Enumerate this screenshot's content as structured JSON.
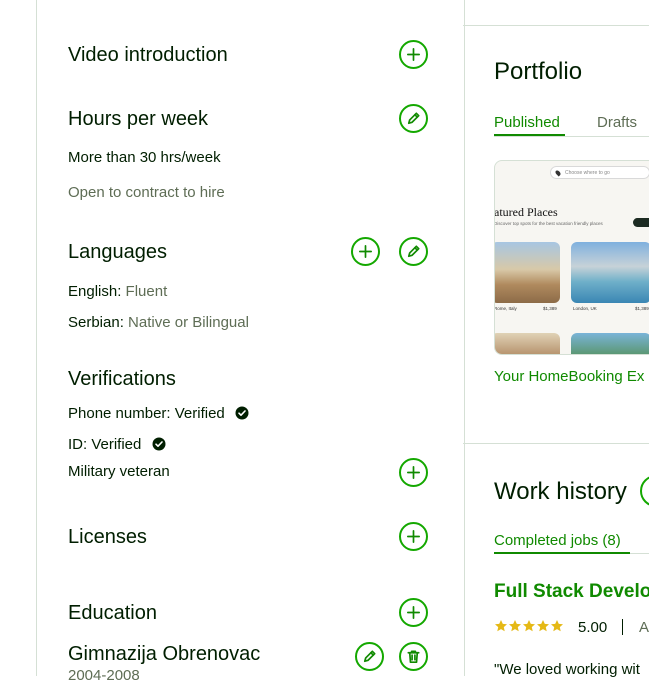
{
  "left": {
    "video": {
      "title": "Video introduction"
    },
    "hours": {
      "title": "Hours per week",
      "value": "More than 30 hrs/week",
      "note": "Open to contract to hire"
    },
    "languages": {
      "title": "Languages",
      "items": [
        {
          "name": "English:",
          "level": "Fluent"
        },
        {
          "name": "Serbian:",
          "level": "Native or Bilingual"
        }
      ]
    },
    "verifications": {
      "title": "Verifications",
      "phone": "Phone number: Verified",
      "id": "ID: Verified",
      "military": "Military veteran"
    },
    "licenses": {
      "title": "Licenses"
    },
    "education": {
      "title": "Education",
      "school": "Gimnazija Obrenovac",
      "years": "2004-2008"
    }
  },
  "portfolio": {
    "title": "Portfolio",
    "tabs": [
      "Published",
      "Drafts"
    ],
    "card": {
      "search_text": "Choose where to go",
      "heading": "atured Places",
      "subheading": "Discover top spots for the best vacation friendly places",
      "places": [
        {
          "name": "Rome, Italy",
          "price": "$1,389"
        },
        {
          "name": "London, UK",
          "price": "$1,389"
        }
      ],
      "caption": "Your HomeBooking Ex"
    }
  },
  "work_history": {
    "title": "Work history",
    "tab": "Completed jobs (8)",
    "job_title": "Full Stack Develo",
    "rating": "5.00",
    "rating_after": "A",
    "quote": "\"We loved working wit"
  },
  "colors": {
    "accent": "#108a00",
    "border": "#d5e0d5",
    "text": "#001e00",
    "muted": "#5e6d55",
    "star": "#e5b916"
  }
}
